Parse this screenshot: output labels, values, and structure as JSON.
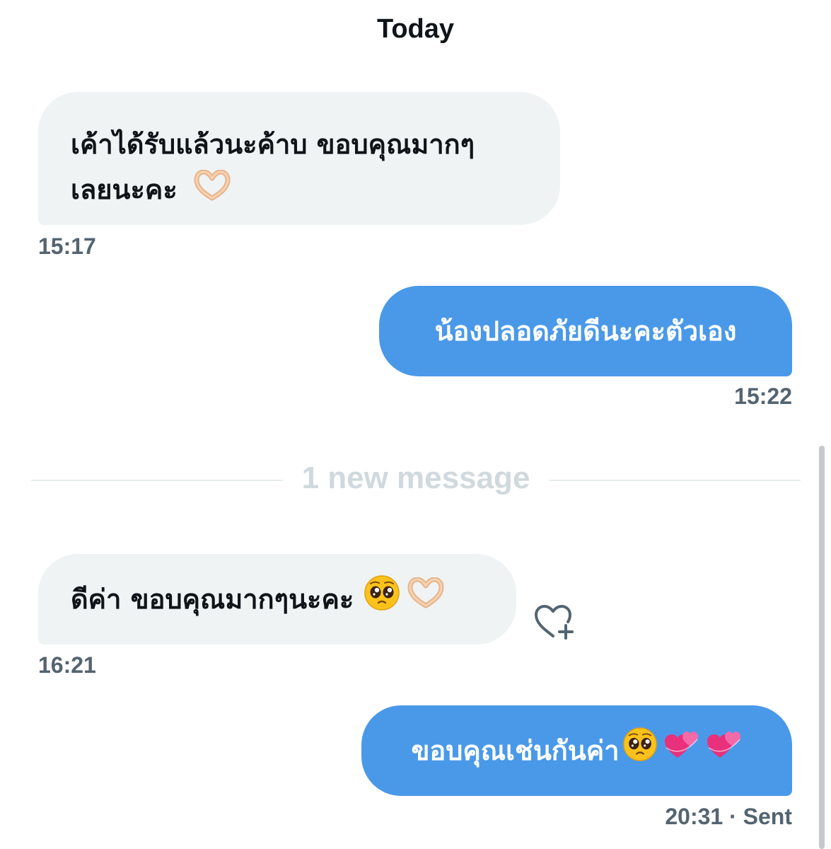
{
  "thread": {
    "date_header": "Today",
    "divider_label": "1 new message"
  },
  "messages": [
    {
      "direction": "received",
      "line1": "เค้าได้รับแล้วนะค้าบ ขอบคุณมากๆ",
      "line2": "เลยนะคะ",
      "emojis": [
        "heart-hands"
      ],
      "time": "15:17"
    },
    {
      "direction": "sent",
      "text": "น้องปลอดภัยดีนะคะตัวเอง",
      "time": "15:22"
    },
    {
      "direction": "received",
      "text": "ดีค่า ขอบคุณมากๆนะคะ",
      "emojis": [
        "pleading-face",
        "heart-hands"
      ],
      "time": "16:21"
    },
    {
      "direction": "sent",
      "text": "ขอบคุณเช่นกันค่า",
      "emojis": [
        "pleading-face",
        "two-hearts",
        "two-hearts"
      ],
      "time": "20:31",
      "status": "· Sent"
    }
  ],
  "colors": {
    "sent_bubble": "#4a99e9",
    "received_bubble": "#eff3f4",
    "timestamp": "#536471",
    "divider_text": "#cfd9de"
  },
  "icons": {
    "reaction": "heart-plus-icon"
  }
}
